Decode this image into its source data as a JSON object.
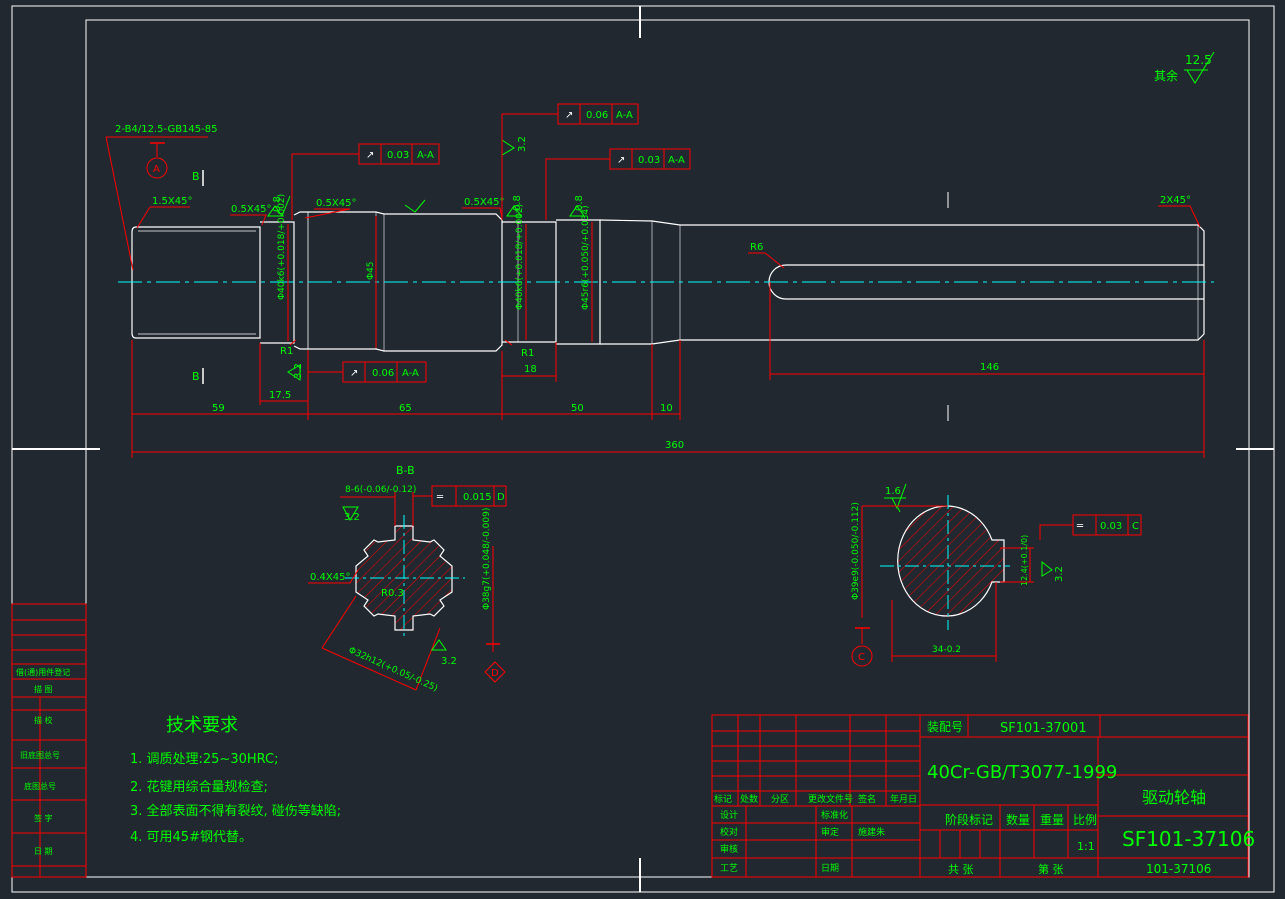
{
  "colors": {
    "background": "#212830",
    "outline": "#ffffff",
    "dimension": "#ff0000",
    "text": "#00ff00",
    "centerline": "#00ffff",
    "hatch": "#ff0000"
  },
  "surface_finish_other": {
    "label": "其余",
    "value": "12.5"
  },
  "main_view": {
    "center_hole": "2-B4/12.5-GB145-85",
    "datum_a": "A",
    "section_mark": "B",
    "chamfer_left": "1.5X45°",
    "chamfer_1": "0.5X45°",
    "roughness_1": "0.8",
    "chamfer_2": "0.5X45°",
    "chamfer_3": "0.5X45°",
    "roughness_2": "0.8",
    "roughness_3": "0.8",
    "roughness_top": "3.2",
    "roughness_bottom": "3.2",
    "chamfer_right": "2X45°",
    "dia_1": "Φ40k6(+0.018/+0.002)",
    "dia_45": "Φ45",
    "dia_2": "Φ40k6(+0.018/+0.002)",
    "dia_3": "Φ45r6(+0.050/+0.034)",
    "radius_r1_a": "R1",
    "radius_r1_b": "R1",
    "radius_r6": "R6",
    "fcf": [
      {
        "sym": "↗",
        "tol": "0.06",
        "datum": "A-A"
      },
      {
        "sym": "↗",
        "tol": "0.03",
        "datum": "A-A"
      },
      {
        "sym": "↗",
        "tol": "0.03",
        "datum": "A-A"
      },
      {
        "sym": "↗",
        "tol": "0.06",
        "datum": "A-A"
      }
    ],
    "dims": {
      "d17_5": "17.5",
      "d18": "18",
      "d146": "146",
      "d59": "59",
      "d65": "65",
      "d50": "50",
      "d10": "10",
      "d360": "360"
    }
  },
  "section_bb": {
    "title": "B-B",
    "spline_width": "8-6(-0.06/-0.12)",
    "fcf": {
      "sym": "═",
      "tol": "0.015",
      "datum": "D"
    },
    "roughness_1": "3.2",
    "roughness_2": "3.2",
    "chamfer": "0.4X45°",
    "radius": "R0.3",
    "minor_dia": "Φ38g7(+0.048/-0.009)",
    "major_dia": "Φ32h12(+0.05/-0.25)",
    "datum_d": "D"
  },
  "section_key": {
    "roughness": "1.6",
    "dia": "Φ39e9(-0.050/-0.112)",
    "fcf": {
      "sym": "═",
      "tol": "0.03",
      "datum": "C"
    },
    "depth": "12.4(+0.1/0)",
    "roughness_2": "3.2",
    "width": "34-0.2",
    "datum_c": "C"
  },
  "tech_req": {
    "title": "技术要求",
    "items": [
      "1. 调质处理:25~30HRC;",
      "2. 花键用综合量规检查;",
      "3. 全部表面不得有裂纹, 碰伤等缺陷;",
      "4. 可用45#钢代替。"
    ]
  },
  "left_strip": [
    "借(通)用件登记",
    "描 图",
    "描 校",
    "旧底图总号",
    "底图总号",
    "签 字",
    "日 期"
  ],
  "title_block": {
    "assembly_label": "装配号",
    "assembly_no": "SF101-37001",
    "material": "40Cr-GB/T3077-1999",
    "part_name": "驱动轮轴",
    "drawing_no": "SF101-37106",
    "drawing_no_small": "101-37106",
    "rev_headers": [
      "标记",
      "处数",
      "分区",
      "更改文件号",
      "签名",
      "年月日"
    ],
    "roles": [
      "设计",
      "校对",
      "审核",
      "工艺"
    ],
    "roles2": [
      "标准化",
      "审定",
      "日期"
    ],
    "approver": "施建朱",
    "stage_label": "阶段标记",
    "qty_label": "数量",
    "weight_label": "重量",
    "scale_label": "比例",
    "scale": "1:1",
    "total_sheets": "共  张",
    "sheet_no": "第  张"
  }
}
